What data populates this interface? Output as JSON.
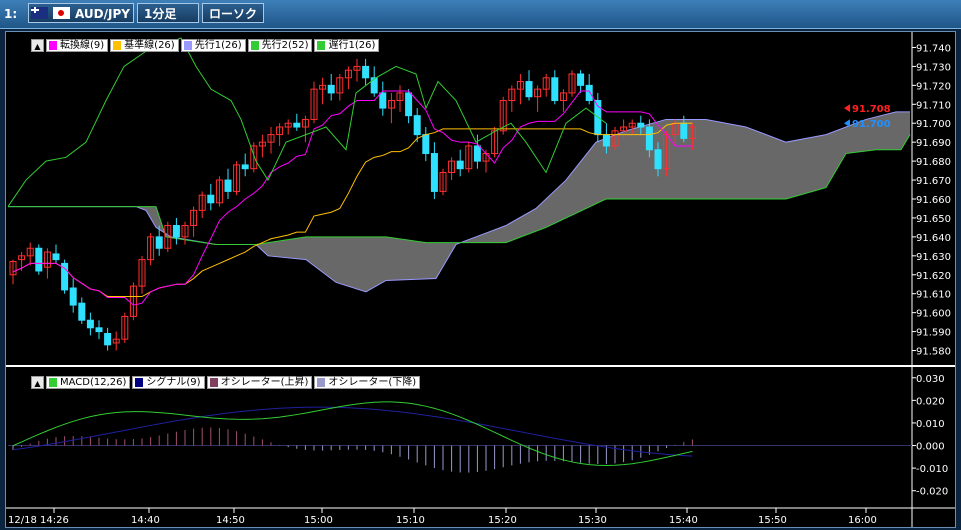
{
  "toolbar": {
    "window_number": "1:",
    "pair": "AUD/JPY",
    "timeframe": "1分足",
    "chart_type": "ローソク"
  },
  "price_panel": {
    "legend": [
      {
        "label": "転換線(9)",
        "color": "#ff00ff"
      },
      {
        "label": "基準線(26)",
        "color": "#ffc000"
      },
      {
        "label": "先行1(26)",
        "color": "#9999ff"
      },
      {
        "label": "先行2(52)",
        "color": "#33cc33"
      },
      {
        "label": "遅行1(26)",
        "color": "#33cc33"
      }
    ],
    "y_ticks": [
      "91.740",
      "91.730",
      "91.720",
      "91.710",
      "91.700",
      "91.690",
      "91.680",
      "91.670",
      "91.660",
      "91.650",
      "91.640",
      "91.630",
      "91.620",
      "91.610",
      "91.600",
      "91.590",
      "91.580"
    ],
    "ask_marker": {
      "value": "91.708",
      "color": "#ff2020"
    },
    "bid_marker": {
      "value": "91.700",
      "color": "#2090ff"
    }
  },
  "macd_panel": {
    "legend": [
      {
        "label": "MACD(12,26)",
        "color": "#33cc33"
      },
      {
        "label": "シグナル(9)",
        "color": "#000080"
      },
      {
        "label": "オシレーター(上昇)",
        "color": "#804060"
      },
      {
        "label": "オシレーター(下降)",
        "color": "#9999cc"
      }
    ],
    "y_ticks": [
      "0.030",
      "0.020",
      "0.010",
      "0.000",
      "-0.010",
      "-0.020"
    ]
  },
  "x_ticks": [
    "12/18 14:26",
    "14:40",
    "14:50",
    "15:00",
    "15:10",
    "15:20",
    "15:30",
    "15:40",
    "15:50",
    "16:00"
  ],
  "colors": {
    "up_candle": "#ff3030",
    "down_candle": "#30e0ff",
    "cloud": "#7a7a7a",
    "background": "#000000"
  },
  "chart_data": {
    "type": "candlestick",
    "y_range": [
      91.575,
      91.745
    ],
    "candles": [
      [
        91.62,
        91.628,
        91.615,
        91.627
      ],
      [
        91.628,
        91.632,
        91.622,
        91.63
      ],
      [
        91.63,
        91.637,
        91.625,
        91.634
      ],
      [
        91.634,
        91.636,
        91.62,
        91.622
      ],
      [
        91.624,
        91.634,
        91.618,
        91.632
      ],
      [
        91.631,
        91.636,
        91.626,
        91.628
      ],
      [
        91.626,
        91.628,
        91.61,
        91.612
      ],
      [
        91.613,
        91.618,
        91.6,
        91.604
      ],
      [
        91.605,
        91.608,
        91.594,
        91.596
      ],
      [
        91.596,
        91.6,
        91.588,
        91.592
      ],
      [
        91.592,
        91.596,
        91.586,
        91.59
      ],
      [
        91.589,
        91.592,
        91.58,
        91.583
      ],
      [
        91.584,
        91.59,
        91.58,
        91.586
      ],
      [
        91.586,
        91.6,
        91.584,
        91.598
      ],
      [
        91.598,
        91.616,
        91.596,
        91.614
      ],
      [
        91.614,
        91.63,
        91.61,
        91.628
      ],
      [
        91.628,
        91.642,
        91.625,
        91.64
      ],
      [
        91.64,
        91.646,
        91.63,
        91.634
      ],
      [
        91.634,
        91.648,
        91.632,
        91.646
      ],
      [
        91.646,
        91.65,
        91.636,
        91.64
      ],
      [
        91.64,
        91.648,
        91.636,
        91.646
      ],
      [
        91.646,
        91.656,
        91.64,
        91.654
      ],
      [
        91.654,
        91.664,
        91.65,
        91.662
      ],
      [
        91.662,
        91.668,
        91.654,
        91.658
      ],
      [
        91.658,
        91.672,
        91.656,
        91.67
      ],
      [
        91.67,
        91.676,
        91.66,
        91.664
      ],
      [
        91.664,
        91.68,
        91.662,
        91.678
      ],
      [
        91.678,
        91.684,
        91.672,
        91.676
      ],
      [
        91.676,
        91.69,
        91.674,
        91.688
      ],
      [
        91.688,
        91.694,
        91.682,
        91.69
      ],
      [
        91.69,
        91.698,
        91.684,
        91.694
      ],
      [
        91.694,
        91.7,
        91.688,
        91.698
      ],
      [
        91.698,
        91.702,
        91.694,
        91.7
      ],
      [
        91.7,
        91.705,
        91.696,
        91.698
      ],
      [
        91.698,
        91.704,
        91.69,
        91.702
      ],
      [
        91.702,
        91.722,
        91.7,
        91.718
      ],
      [
        91.718,
        91.724,
        91.71,
        91.72
      ],
      [
        91.72,
        91.726,
        91.712,
        91.716
      ],
      [
        91.716,
        91.726,
        91.712,
        91.724
      ],
      [
        91.724,
        91.73,
        91.718,
        91.728
      ],
      [
        91.728,
        91.734,
        91.722,
        91.73
      ],
      [
        91.73,
        91.734,
        91.72,
        91.724
      ],
      [
        91.724,
        91.73,
        91.714,
        91.716
      ],
      [
        91.716,
        91.722,
        91.704,
        91.708
      ],
      [
        91.708,
        91.716,
        91.7,
        91.712
      ],
      [
        91.712,
        91.72,
        91.706,
        91.716
      ],
      [
        91.716,
        91.718,
        91.7,
        91.704
      ],
      [
        91.704,
        91.708,
        91.69,
        91.694
      ],
      [
        91.694,
        91.698,
        91.68,
        91.684
      ],
      [
        91.684,
        91.69,
        91.66,
        91.664
      ],
      [
        91.664,
        91.676,
        91.662,
        91.674
      ],
      [
        91.674,
        91.682,
        91.67,
        91.68
      ],
      [
        91.68,
        91.686,
        91.672,
        91.676
      ],
      [
        91.676,
        91.69,
        91.674,
        91.688
      ],
      [
        91.688,
        91.694,
        91.676,
        91.68
      ],
      [
        91.68,
        91.686,
        91.674,
        91.684
      ],
      [
        91.684,
        91.698,
        91.682,
        91.696
      ],
      [
        91.696,
        91.714,
        91.694,
        91.712
      ],
      [
        91.712,
        91.72,
        91.706,
        91.718
      ],
      [
        91.718,
        91.726,
        91.71,
        91.722
      ],
      [
        91.722,
        91.728,
        91.712,
        91.714
      ],
      [
        91.714,
        91.72,
        91.706,
        91.718
      ],
      [
        91.718,
        91.726,
        91.714,
        91.724
      ],
      [
        91.724,
        91.728,
        91.71,
        91.712
      ],
      [
        91.712,
        91.718,
        91.706,
        91.716
      ],
      [
        91.716,
        91.728,
        91.714,
        91.726
      ],
      [
        91.726,
        91.728,
        91.716,
        91.72
      ],
      [
        91.72,
        91.726,
        91.71,
        91.712
      ],
      [
        91.712,
        91.716,
        91.69,
        91.694
      ],
      [
        91.694,
        91.7,
        91.684,
        91.688
      ],
      [
        91.688,
        91.698,
        91.686,
        91.696
      ],
      [
        91.696,
        91.702,
        91.692,
        91.698
      ],
      [
        91.698,
        91.702,
        91.694,
        91.7
      ],
      [
        91.7,
        91.704,
        91.694,
        91.698
      ],
      [
        91.698,
        91.702,
        91.682,
        91.686
      ],
      [
        91.686,
        91.69,
        91.672,
        91.676
      ],
      [
        91.676,
        91.696,
        91.672,
        91.694
      ],
      [
        91.694,
        91.702,
        91.688,
        91.7
      ],
      [
        91.7,
        91.704,
        91.69,
        91.692
      ],
      [
        91.692,
        91.7,
        91.686,
        91.698
      ]
    ]
  }
}
